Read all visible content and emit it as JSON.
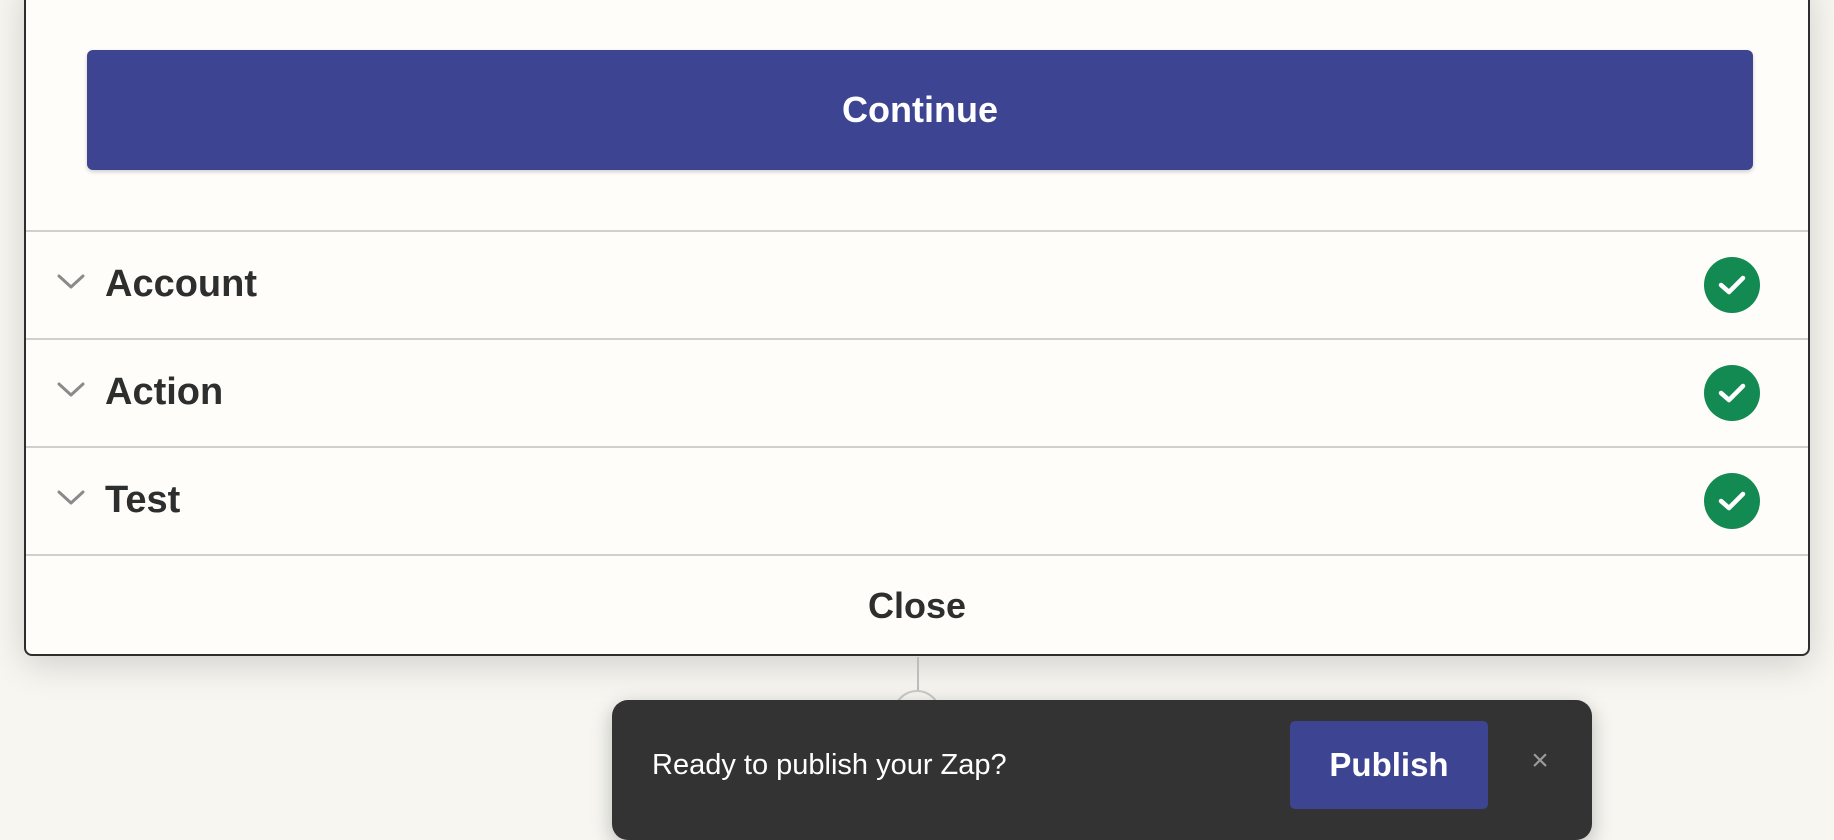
{
  "panel": {
    "continue_label": "Continue",
    "sections": [
      {
        "label": "Account",
        "status_icon": "check-circle-icon",
        "expand_icon": "chevron-down-icon",
        "completed": true
      },
      {
        "label": "Action",
        "status_icon": "check-circle-icon",
        "expand_icon": "chevron-down-icon",
        "completed": true
      },
      {
        "label": "Test",
        "status_icon": "check-circle-icon",
        "expand_icon": "chevron-down-icon",
        "completed": true
      }
    ],
    "close_label": "Close"
  },
  "toast": {
    "message": "Ready to publish your Zap?",
    "publish_label": "Publish",
    "close_icon": "×"
  },
  "colors": {
    "primary": "#3d4592",
    "success": "#138a52",
    "toast_bg": "#333333",
    "panel_bg": "#fffdf9",
    "page_bg": "#f7f6f1"
  }
}
